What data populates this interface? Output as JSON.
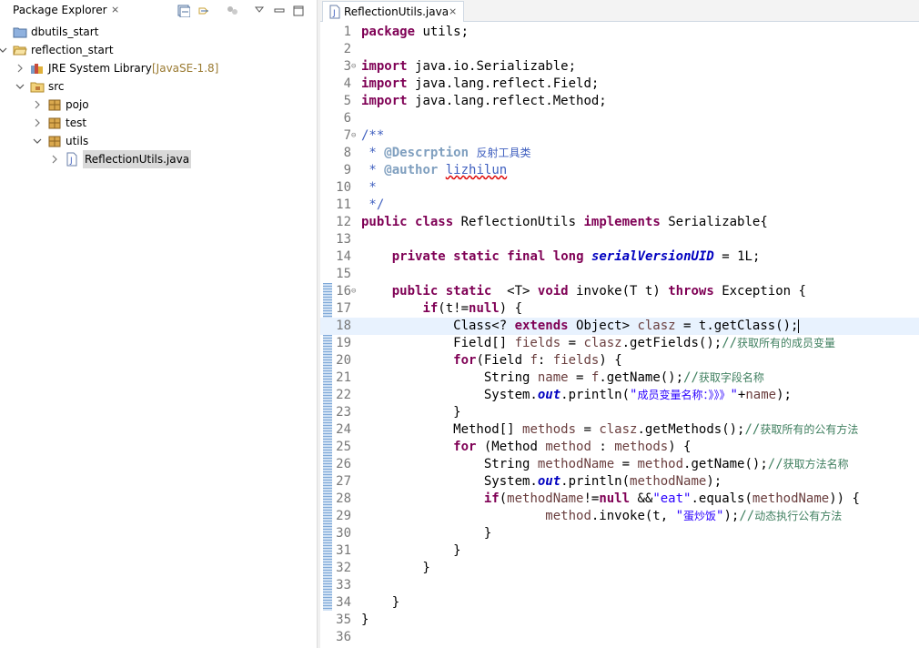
{
  "explorer": {
    "title": "Package Explorer",
    "close": "⨯",
    "toolbar": [
      "collapse-all-icon",
      "link-with-editor-icon",
      "filter-icon",
      "view-menu-icon",
      "minimize-icon",
      "maximize-icon"
    ],
    "tree": [
      {
        "label": "dbutils_start",
        "extra": "",
        "icon": "project-icon",
        "depth": 0,
        "twisty": ""
      },
      {
        "label": "reflection_start",
        "extra": "",
        "icon": "project-open-icon",
        "depth": 0,
        "twisty": "open"
      },
      {
        "label": "JRE System Library",
        "extra": "[JavaSE-1.8]",
        "icon": "library-icon",
        "depth": 1,
        "twisty": "closed"
      },
      {
        "label": "src",
        "extra": "",
        "icon": "source-folder-icon",
        "depth": 1,
        "twisty": "open"
      },
      {
        "label": "pojo",
        "extra": "",
        "icon": "package-icon",
        "depth": 2,
        "twisty": "closed"
      },
      {
        "label": "test",
        "extra": "",
        "icon": "package-icon",
        "depth": 2,
        "twisty": "closed"
      },
      {
        "label": "utils",
        "extra": "",
        "icon": "package-icon",
        "depth": 2,
        "twisty": "open"
      },
      {
        "label": "ReflectionUtils.java",
        "extra": "",
        "icon": "java-file-icon",
        "depth": 3,
        "twisty": "closed",
        "selected": true
      }
    ]
  },
  "editor": {
    "tab_label": "ReflectionUtils.java",
    "tab_close": "⨯",
    "current_line": 18,
    "code": [
      {
        "n": "1",
        "fold": "",
        "segs": [
          [
            "kw",
            "package"
          ],
          [
            "",
            "utils;"
          ]
        ]
      },
      {
        "n": "2",
        "fold": "",
        "segs": []
      },
      {
        "n": "3",
        "fold": "⊖",
        "segs": [
          [
            "kw",
            "import"
          ],
          [
            "",
            "java.io.Serializable;"
          ]
        ]
      },
      {
        "n": "4",
        "fold": "",
        "segs": [
          [
            "kw",
            "import"
          ],
          [
            "",
            "java.lang.reflect.Field;"
          ]
        ]
      },
      {
        "n": "5",
        "fold": "",
        "segs": [
          [
            "kw",
            "import"
          ],
          [
            "",
            "java.lang.reflect.Method;"
          ]
        ]
      },
      {
        "n": "6",
        "fold": "",
        "segs": []
      },
      {
        "n": "7",
        "fold": "⊖",
        "segs": [
          [
            "jd",
            "/**"
          ]
        ]
      },
      {
        "n": "8",
        "fold": "",
        "segs": [
          [
            "jd",
            " * "
          ],
          [
            "tag",
            "@Descrption"
          ],
          [
            "jd",
            " "
          ],
          [
            "jd cjk",
            "反射工具类"
          ]
        ]
      },
      {
        "n": "9",
        "fold": "",
        "segs": [
          [
            "jd",
            " * "
          ],
          [
            "tag",
            "@author"
          ],
          [
            "jd",
            " "
          ],
          [
            "jd squig",
            "lizhilun"
          ]
        ]
      },
      {
        "n": "10",
        "fold": "",
        "segs": [
          [
            "jd",
            " *"
          ]
        ]
      },
      {
        "n": "11",
        "fold": "",
        "segs": [
          [
            "jd",
            " */"
          ]
        ]
      },
      {
        "n": "12",
        "fold": "",
        "segs": [
          [
            "kw",
            "public"
          ],
          [
            "",
            " "
          ],
          [
            "kw",
            "class"
          ],
          [
            "",
            " ReflectionUtils "
          ],
          [
            "kw",
            "implements"
          ],
          [
            "",
            " Serializable{"
          ]
        ]
      },
      {
        "n": "13",
        "fold": "",
        "segs": []
      },
      {
        "n": "14",
        "fold": "",
        "segs": [
          [
            "",
            "    "
          ],
          [
            "kw",
            "private"
          ],
          [
            "",
            " "
          ],
          [
            "kw",
            "static"
          ],
          [
            "",
            " "
          ],
          [
            "kw",
            "final"
          ],
          [
            "",
            " "
          ],
          [
            "kw",
            "long"
          ],
          [
            "",
            " "
          ],
          [
            "sfi",
            "serialVersionUID"
          ],
          [
            "",
            " = 1L;"
          ]
        ]
      },
      {
        "n": "15",
        "fold": "",
        "segs": []
      },
      {
        "n": "16",
        "fold": "⊖",
        "segs": [
          [
            "",
            "    "
          ],
          [
            "kw",
            "public"
          ],
          [
            "",
            " "
          ],
          [
            "kw",
            "static"
          ],
          [
            "",
            "  <T> "
          ],
          [
            "kw",
            "void"
          ],
          [
            "",
            " invoke(T t) "
          ],
          [
            "kw",
            "throws"
          ],
          [
            "",
            " Exception {"
          ]
        ]
      },
      {
        "n": "17",
        "fold": "",
        "segs": [
          [
            "",
            "        "
          ],
          [
            "kw",
            "if"
          ],
          [
            "",
            "(t!="
          ],
          [
            "kw",
            "null"
          ],
          [
            "",
            ") {"
          ]
        ]
      },
      {
        "n": "18",
        "fold": "",
        "segs": [
          [
            "",
            "            Class<? "
          ],
          [
            "kw",
            "extends"
          ],
          [
            "",
            " Object> "
          ],
          [
            "var",
            "clasz"
          ],
          [
            "",
            " = t.getClass();"
          ]
        ]
      },
      {
        "n": "19",
        "fold": "",
        "segs": [
          [
            "",
            "            Field[] "
          ],
          [
            "var",
            "fields"
          ],
          [
            "",
            " = "
          ],
          [
            "var",
            "clasz"
          ],
          [
            "",
            ".getFields();"
          ],
          [
            "cm",
            "//"
          ],
          [
            "cm cjk",
            "获取所有的成员变量"
          ]
        ]
      },
      {
        "n": "20",
        "fold": "",
        "segs": [
          [
            "",
            "            "
          ],
          [
            "kw",
            "for"
          ],
          [
            "",
            "(Field "
          ],
          [
            "var",
            "f"
          ],
          [
            "",
            ": "
          ],
          [
            "var",
            "fields"
          ],
          [
            "",
            ") {"
          ]
        ]
      },
      {
        "n": "21",
        "fold": "",
        "segs": [
          [
            "",
            "                String "
          ],
          [
            "var",
            "name"
          ],
          [
            "",
            " = "
          ],
          [
            "var",
            "f"
          ],
          [
            "",
            ".getName();"
          ],
          [
            "cm",
            "//"
          ],
          [
            "cm cjk",
            "获取字段名称"
          ]
        ]
      },
      {
        "n": "22",
        "fold": "",
        "segs": [
          [
            "",
            "                System."
          ],
          [
            "sfi",
            "out"
          ],
          [
            "",
            ".println("
          ],
          [
            "st",
            "\""
          ],
          [
            "st cjk",
            "成员变量名称：》》》"
          ],
          [
            "st",
            "\""
          ],
          [
            "",
            "+"
          ],
          [
            "var",
            "name"
          ],
          [
            "",
            ");"
          ]
        ]
      },
      {
        "n": "23",
        "fold": "",
        "segs": [
          [
            "",
            "            }"
          ]
        ]
      },
      {
        "n": "24",
        "fold": "",
        "segs": [
          [
            "",
            "            Method[] "
          ],
          [
            "var",
            "methods"
          ],
          [
            "",
            " = "
          ],
          [
            "var",
            "clasz"
          ],
          [
            "",
            ".getMethods();"
          ],
          [
            "cm",
            "//"
          ],
          [
            "cm cjk",
            "获取所有的公有方法"
          ]
        ]
      },
      {
        "n": "25",
        "fold": "",
        "segs": [
          [
            "",
            "            "
          ],
          [
            "kw",
            "for"
          ],
          [
            "",
            " (Method "
          ],
          [
            "var",
            "method"
          ],
          [
            "",
            " : "
          ],
          [
            "var",
            "methods"
          ],
          [
            "",
            ") {"
          ]
        ]
      },
      {
        "n": "26",
        "fold": "",
        "segs": [
          [
            "",
            "                String "
          ],
          [
            "var",
            "methodName"
          ],
          [
            "",
            " = "
          ],
          [
            "var",
            "method"
          ],
          [
            "",
            ".getName();"
          ],
          [
            "cm",
            "//"
          ],
          [
            "cm cjk",
            "获取方法名称"
          ]
        ]
      },
      {
        "n": "27",
        "fold": "",
        "segs": [
          [
            "",
            "                System."
          ],
          [
            "sfi",
            "out"
          ],
          [
            "",
            ".println("
          ],
          [
            "var",
            "methodName"
          ],
          [
            "",
            ");"
          ]
        ]
      },
      {
        "n": "28",
        "fold": "",
        "segs": [
          [
            "",
            "                "
          ],
          [
            "kw",
            "if"
          ],
          [
            "",
            "("
          ],
          [
            "var",
            "methodName"
          ],
          [
            "",
            "!="
          ],
          [
            "kw",
            "null"
          ],
          [
            "",
            "&&"
          ],
          [
            "st",
            "\"eat\""
          ],
          [
            "",
            ".equals("
          ],
          [
            "var",
            "methodName"
          ],
          [
            "",
            ")) {"
          ]
        ]
      },
      {
        "n": "29",
        "fold": "",
        "segs": [
          [
            "",
            "                        "
          ],
          [
            "var",
            "method"
          ],
          [
            "",
            ".invoke(t, "
          ],
          [
            "st",
            "\""
          ],
          [
            "st cjk",
            "蛋炒饭"
          ],
          [
            "st",
            "\""
          ],
          [
            "",
            ");"
          ],
          [
            "cm",
            "//"
          ],
          [
            "cm cjk",
            "动态执行公有方法"
          ]
        ]
      },
      {
        "n": "30",
        "fold": "",
        "segs": [
          [
            "",
            "                }"
          ]
        ]
      },
      {
        "n": "31",
        "fold": "",
        "segs": [
          [
            "",
            "            }"
          ]
        ]
      },
      {
        "n": "32",
        "fold": "",
        "segs": [
          [
            "",
            "        }"
          ]
        ]
      },
      {
        "n": "33",
        "fold": "",
        "segs": []
      },
      {
        "n": "34",
        "fold": "",
        "segs": [
          [
            "",
            "    }"
          ]
        ]
      },
      {
        "n": "35",
        "fold": "",
        "segs": [
          [
            "",
            "}"
          ]
        ]
      },
      {
        "n": "36",
        "fold": "",
        "segs": []
      }
    ]
  }
}
